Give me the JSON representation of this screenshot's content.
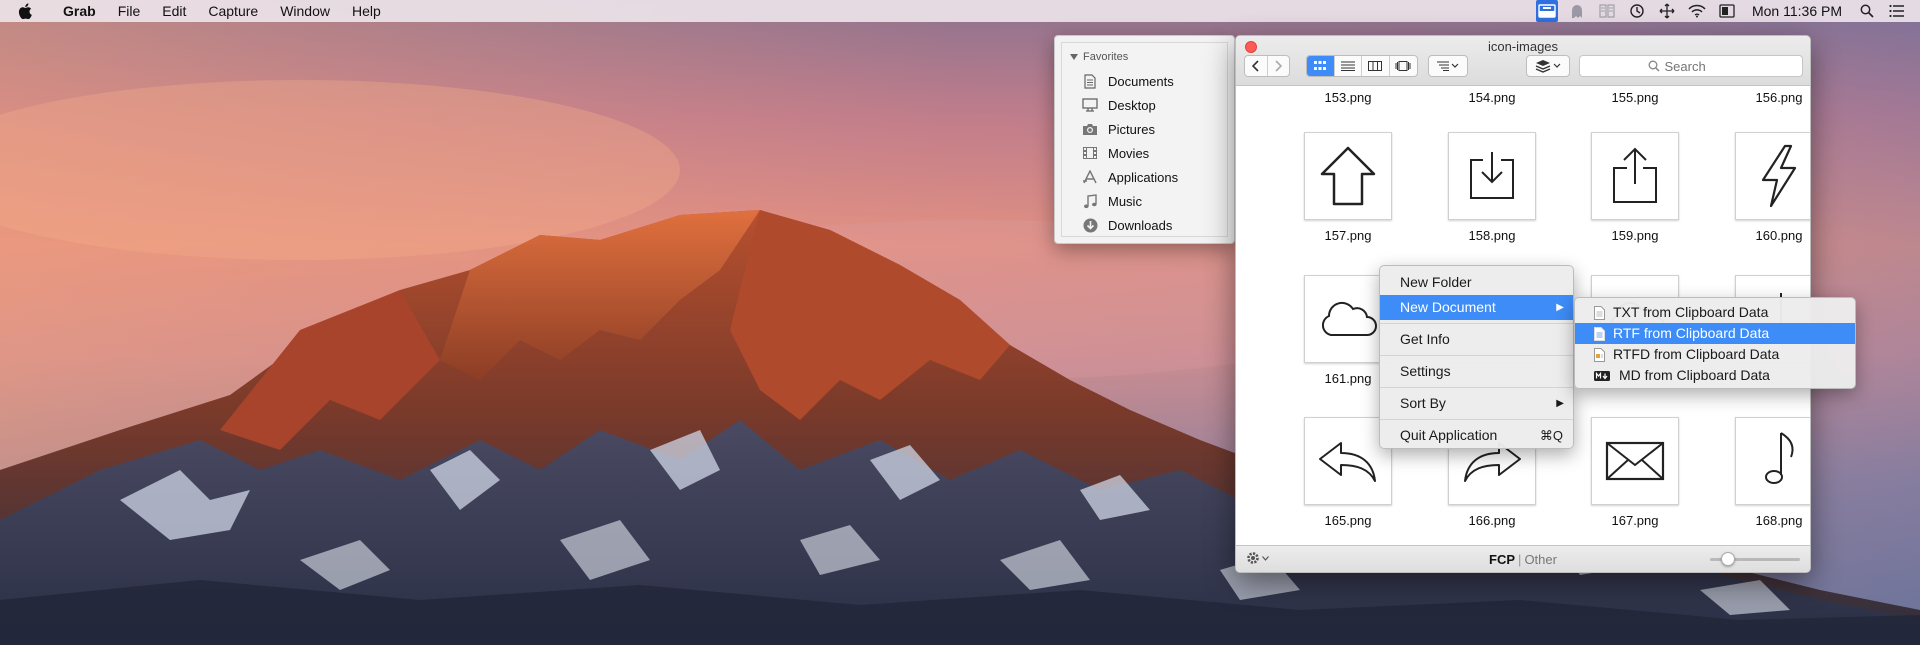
{
  "menubar": {
    "apple_icon": "apple-icon",
    "app_name": "Grab",
    "menus": [
      "File",
      "Edit",
      "Capture",
      "Window",
      "Help"
    ],
    "status_icons": [
      "tray-icon",
      "ghost-icon",
      "book-icon",
      "time-machine-icon",
      "move-icon",
      "wifi-icon",
      "display-icon"
    ],
    "clock": "Mon 11:36 PM",
    "right_icons": [
      "search-icon",
      "list-icon"
    ]
  },
  "sidebar": {
    "header": "Favorites",
    "items": [
      {
        "label": "Documents",
        "icon": "document-icon"
      },
      {
        "label": "Desktop",
        "icon": "desktop-icon"
      },
      {
        "label": "Pictures",
        "icon": "camera-icon"
      },
      {
        "label": "Movies",
        "icon": "film-icon"
      },
      {
        "label": "Applications",
        "icon": "applications-icon"
      },
      {
        "label": "Music",
        "icon": "music-note-icon"
      },
      {
        "label": "Downloads",
        "icon": "download-icon"
      }
    ]
  },
  "window": {
    "title": "icon-images",
    "search": {
      "placeholder": "Search"
    },
    "view_mode": "icon"
  },
  "files": {
    "row0": [
      "153.png",
      "154.png",
      "155.png",
      "156.png"
    ],
    "row1": [
      {
        "name": "157.png",
        "icon": "arrow-up-icon"
      },
      {
        "name": "158.png",
        "icon": "download-tray-icon"
      },
      {
        "name": "159.png",
        "icon": "share-icon"
      },
      {
        "name": "160.png",
        "icon": "lightning-icon"
      }
    ],
    "row2": [
      {
        "name": "161.png",
        "icon": "cloud-icon"
      }
    ],
    "row3": [
      {
        "name": "165.png",
        "icon": "reply-icon"
      },
      {
        "name": "166.png",
        "icon": "forward-icon"
      },
      {
        "name": "167.png",
        "icon": "envelope-icon"
      },
      {
        "name": "168.png",
        "icon": "music-note-icon"
      }
    ]
  },
  "statusbar": {
    "active_tag": "FCP",
    "separator": "|",
    "other_tag": "Other",
    "zoom_fraction": 0.15
  },
  "context_menu": {
    "items": [
      {
        "label": "New Folder"
      },
      {
        "label": "New Document",
        "submenu": true,
        "highlighted": true
      },
      {
        "label": "Get Info"
      },
      {
        "label": "Settings"
      },
      {
        "label": "Sort By",
        "submenu": true
      },
      {
        "label": "Quit Application",
        "shortcut": "⌘Q"
      }
    ]
  },
  "submenu": {
    "items": [
      {
        "label": "TXT from Clipboard Data",
        "icon": "txt-file-icon"
      },
      {
        "label": "RTF from Clipboard Data",
        "icon": "rtf-file-icon",
        "highlighted": true
      },
      {
        "label": "RTFD from Clipboard Data",
        "icon": "rtfd-file-icon"
      },
      {
        "label": "MD from Clipboard Data",
        "icon": "markdown-icon",
        "badge": "M↓"
      }
    ]
  },
  "colors": {
    "accent": "#3d8cf7",
    "close": "#fc5b57"
  }
}
